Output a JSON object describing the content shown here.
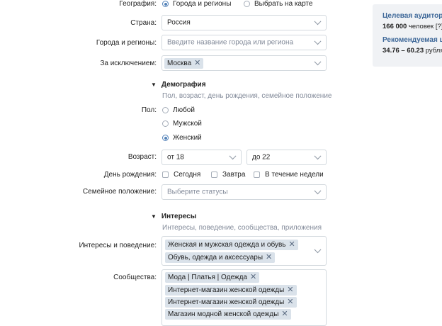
{
  "geography": {
    "label": "География:",
    "options": [
      {
        "label": "Города и регионы",
        "selected": true
      },
      {
        "label": "Выбрать на карте",
        "selected": false
      }
    ]
  },
  "country": {
    "label": "Страна:",
    "value": "Россия"
  },
  "cities": {
    "label": "Города и регионы:",
    "placeholder": "Введите название города или региона"
  },
  "exclusions": {
    "label": "За исключением:",
    "tags": [
      "Москва"
    ]
  },
  "demography": {
    "title": "Демография",
    "subtitle": "Пол, возраст, день рождения, семейное положение",
    "gender": {
      "label": "Пол:",
      "options": [
        {
          "label": "Любой",
          "selected": false
        },
        {
          "label": "Мужской",
          "selected": false
        },
        {
          "label": "Женский",
          "selected": true
        }
      ]
    },
    "age": {
      "label": "Возраст:",
      "from": "от 18",
      "to": "до 22"
    },
    "birthday": {
      "label": "День рождения:",
      "options": [
        "Сегодня",
        "Завтра",
        "В течение недели"
      ]
    },
    "marital": {
      "label": "Семейное положение:",
      "placeholder": "Выберите статусы"
    }
  },
  "interests": {
    "title": "Интересы",
    "subtitle": "Интересы, поведение, сообщества, приложения",
    "behavior": {
      "label": "Интересы и поведение:",
      "tags": [
        "Женская и мужская одежда и обувь",
        "Обувь, одежда и аксессуары"
      ]
    },
    "communities": {
      "label": "Сообщества:",
      "tags": [
        "Мода | Платья | Одежда",
        "Интернет-магазин женской одежды",
        "Интернет-магазин женской одежды",
        "Магазин модной женской одежды"
      ]
    }
  },
  "sidebar": {
    "audience_title": "Целевая аудитори",
    "audience_value": "166 000",
    "audience_unit": "человек [?]",
    "price_title": "Рекомендуемая ц",
    "price_value": "34.76 – 60.23",
    "price_unit": "рубля"
  },
  "colors": {
    "accent": "#5181b8",
    "tag_bg": "#dae2ea",
    "border": "#d3d9de",
    "muted": "#828a99",
    "sidebar_bg": "#f0f2f5",
    "sidebar_title": "#3d6798"
  }
}
